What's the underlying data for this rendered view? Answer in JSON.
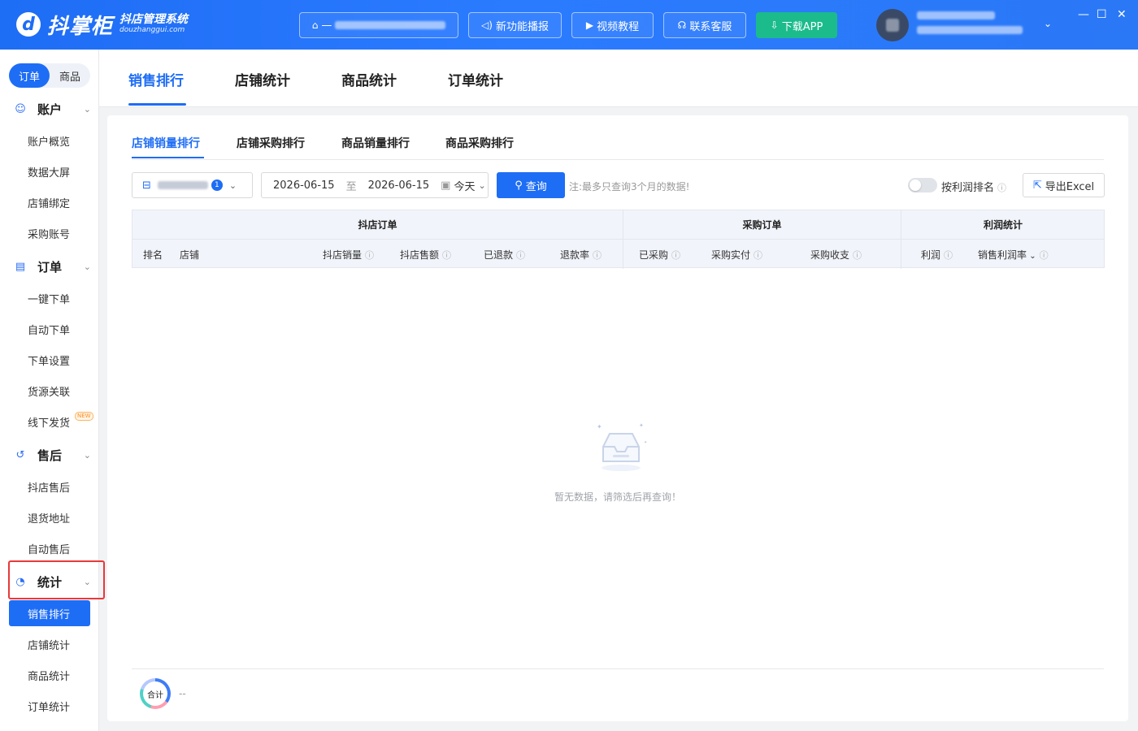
{
  "app": {
    "name": "抖掌柜",
    "subtitle": "抖店管理系统",
    "domain": "douzhanggui.com"
  },
  "header": {
    "store_selector_prefix": "—",
    "buttons": [
      {
        "label": "新功能播报",
        "icon": "speaker-icon"
      },
      {
        "label": "视频教程",
        "icon": "video-icon"
      },
      {
        "label": "联系客服",
        "icon": "headset-icon"
      },
      {
        "label": "下载APP",
        "icon": "download-icon"
      }
    ],
    "accent": "#1e6df5",
    "download_color": "#1bbb8c"
  },
  "sidebar": {
    "segment": [
      "订单",
      "商品"
    ],
    "groups": [
      {
        "label": "账户",
        "icon": "smile-icon",
        "items": [
          "账户概览",
          "数据大屏",
          "店铺绑定",
          "采购账号"
        ]
      },
      {
        "label": "订单",
        "icon": "order-icon",
        "items": [
          "一键下单",
          "自动下单",
          "下单设置",
          "货源关联",
          "线下发货"
        ]
      },
      {
        "label": "售后",
        "icon": "return-icon",
        "items": [
          "抖店售后",
          "退货地址",
          "自动售后"
        ]
      },
      {
        "label": "统计",
        "icon": "pie-chart-icon",
        "items": [
          "销售排行",
          "店铺统计",
          "商品统计",
          "订单统计"
        ]
      }
    ],
    "new_badge": "NEW",
    "active_item": "销售排行"
  },
  "main_tabs": [
    "销售排行",
    "店铺统计",
    "商品统计",
    "订单统计"
  ],
  "sub_tabs": [
    "店铺销量排行",
    "店铺采购排行",
    "商品销量排行",
    "商品采购排行"
  ],
  "filters": {
    "shop_count": "1",
    "date_from": "2026-06-15",
    "date_sep": "至",
    "date_to": "2026-06-15",
    "quick_range": "今天",
    "query_label": "查询",
    "note": "注:最多只查询3个月的数据!",
    "profit_sort_label": "按利润排名",
    "export_label": "导出Excel"
  },
  "table": {
    "groups": [
      "抖店订单",
      "采购订单",
      "利润统计"
    ],
    "columns": [
      "排名",
      "店铺",
      "抖店销量",
      "抖店售额",
      "已退款",
      "退款率",
      "已采购",
      "采购实付",
      "采购收支",
      "利润",
      "销售利润率"
    ]
  },
  "empty_text": "暂无数据，请筛选后再查询！",
  "footer": {
    "total_label": "合计",
    "total_value": "--"
  }
}
